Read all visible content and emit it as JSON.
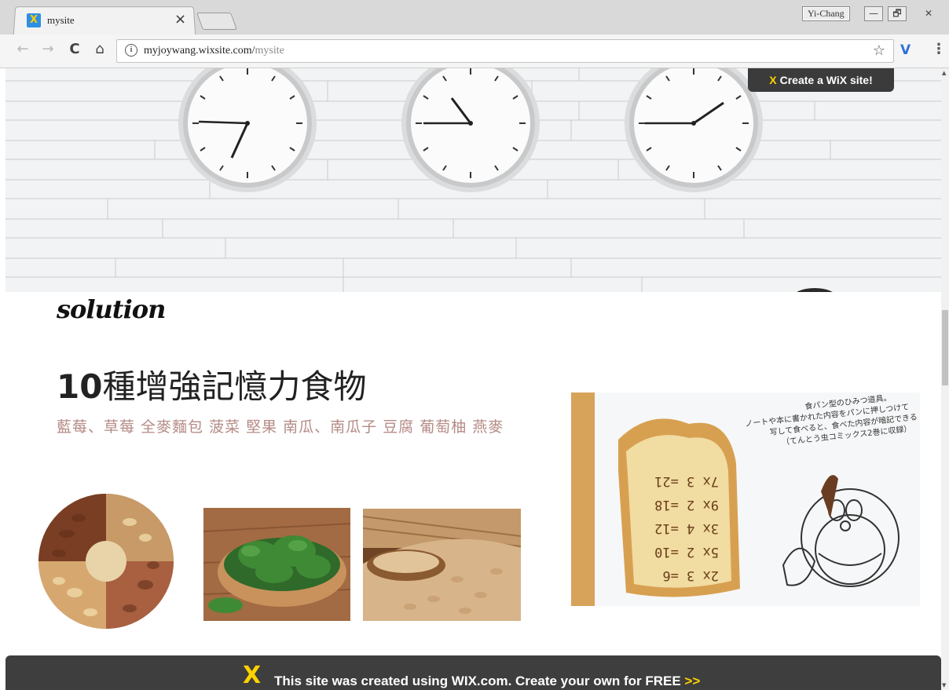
{
  "browser": {
    "tab_title": "mysite",
    "tab_close": "×",
    "profile_name": "Yi-Chang",
    "win_min": "—",
    "win_max": "🗗",
    "win_close": "✕",
    "nav": {
      "back": "←",
      "forward": "→",
      "reload": "C",
      "home": "⌂"
    },
    "info_icon": "i",
    "url_host": "myjoywang.wixsite.com/",
    "url_path": "mysite",
    "star": "☆",
    "extension": "V",
    "menu": "⋮"
  },
  "page": {
    "wix_create_label": "Create a WiX site!",
    "wix_create_logo": "X",
    "solution_heading": "solution",
    "foods_heading_num": "10",
    "foods_heading_text": "種增強記憶力食物",
    "foods_list": "藍莓、草莓   全麥麵包 菠菜  堅果  南瓜、南瓜子  豆腐  葡萄柚  燕麥",
    "banner_logo": "X",
    "banner_text": "This site was created using WIX.com. Create your own for FREE ",
    "banner_arrows": ">>"
  },
  "toast_card": {
    "jp_line1": "食パン型のひみつ道具。",
    "jp_line2": "ノートや本に書かれた内容をパンに押しつけて",
    "jp_line3": "写して食べると、食べた内容が暗記できる",
    "jp_line4": "（てんとう虫コミックス2巻に収録）",
    "toast_lines": [
      "2x 3 =6",
      "5x 2 =10",
      "3x 4 =12",
      "9x 2 =18",
      "7x 3 =21"
    ]
  },
  "colors": {
    "accent_yellow": "#ffd200",
    "banner_bg": "#3e3e3e",
    "food_list": "#b58b86"
  }
}
